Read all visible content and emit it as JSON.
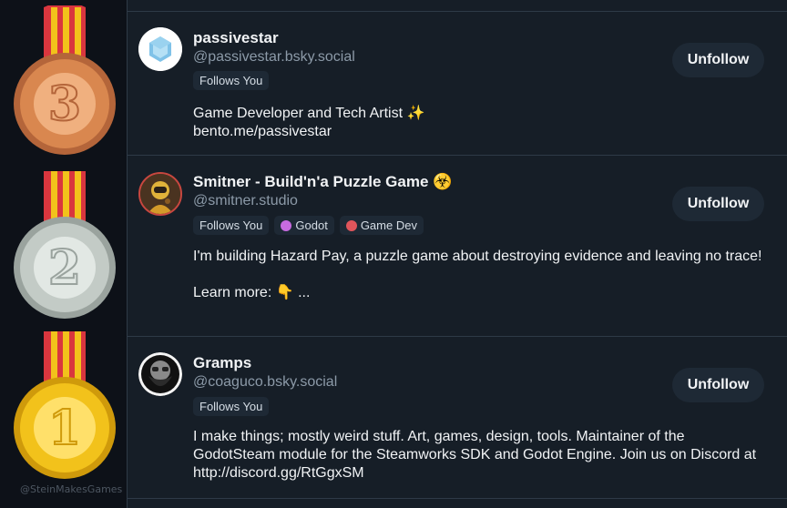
{
  "watermark": "@SteinMakesGames",
  "medals": [
    {
      "numeral": "3",
      "rank_name": "bronze",
      "face": "#d9874f",
      "face_dark": "#b4653a",
      "face_light": "#f0b07f"
    },
    {
      "numeral": "2",
      "rank_name": "silver",
      "face": "#c3cbc6",
      "face_dark": "#9aa39e",
      "face_light": "#e2e8e4"
    },
    {
      "numeral": "1",
      "rank_name": "gold",
      "face": "#f2c21b",
      "face_dark": "#cf9a0b",
      "face_light": "#ffe06a"
    }
  ],
  "ribbon_colors": {
    "red": "#d9363e",
    "yellow": "#f2c21b"
  },
  "follows": [
    {
      "name": "passivestar",
      "handle": "@passivestar.bsky.social",
      "tags": [
        {
          "label": "Follows You"
        }
      ],
      "bio": [
        "Game Developer and Tech Artist ✨",
        "bento.me/passivestar"
      ],
      "button": "Unfollow",
      "avatar_icon": "hexagon-logo-icon"
    },
    {
      "name": "Smitner - Build'n'a Puzzle Game ☣️",
      "handle": "@smitner.studio",
      "tags": [
        {
          "label": "Follows You"
        },
        {
          "label": "Godot",
          "dot_color": "#c86be0"
        },
        {
          "label": "Game Dev",
          "dot_color": "#e0555b"
        }
      ],
      "bio": [
        "I'm building Hazard Pay, a puzzle game about destroying evidence and leaving no trace!",
        "",
        "Learn more: 👇 ..."
      ],
      "button": "Unfollow",
      "avatar_icon": "hazmat-character-icon"
    },
    {
      "name": "Gramps",
      "handle": "@coaguco.bsky.social",
      "tags": [
        {
          "label": "Follows You"
        }
      ],
      "bio": [
        "I make things; mostly weird stuff. Art, games, design, tools. Maintainer of the GodotSteam module for the Steamworks SDK and Godot Engine. Join us on Discord at http://discord.gg/RtGgxSM"
      ],
      "button": "Unfollow",
      "avatar_icon": "bearded-face-icon"
    }
  ]
}
